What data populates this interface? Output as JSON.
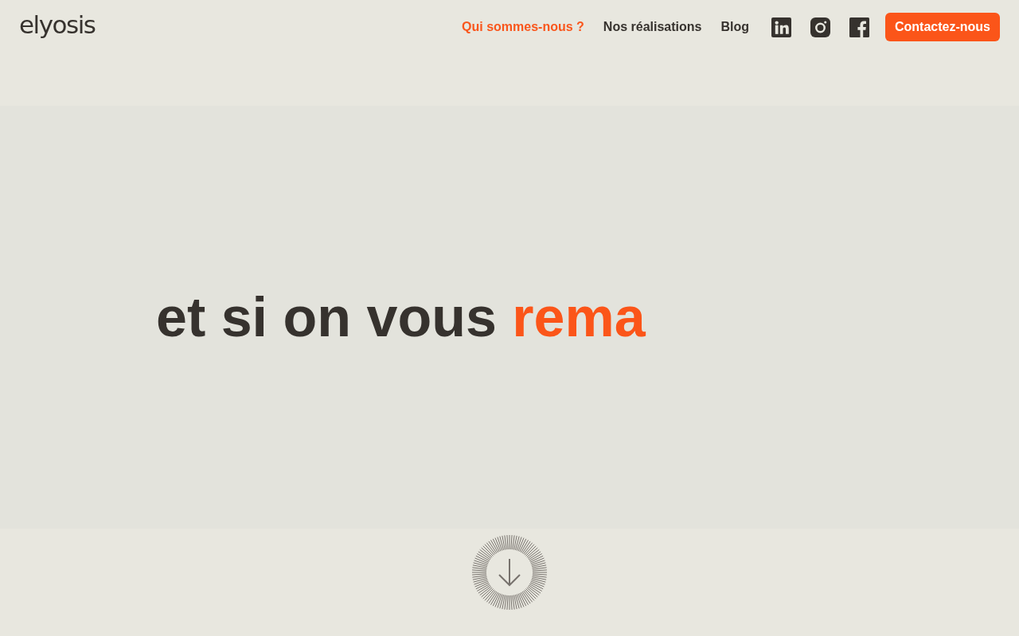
{
  "logo": {
    "text": "elyosis"
  },
  "nav": {
    "links": [
      {
        "label": "Qui sommes-nous ?",
        "selected": true
      },
      {
        "label": "Nos réalisations",
        "selected": false
      },
      {
        "label": "Blog",
        "selected": false
      }
    ],
    "social": [
      {
        "kind": "linkedin"
      },
      {
        "kind": "instagram"
      },
      {
        "kind": "facebook"
      }
    ],
    "cta": "Contactez-nous"
  },
  "hero": {
    "headline": "et si on vous",
    "highlight": "rema"
  }
}
